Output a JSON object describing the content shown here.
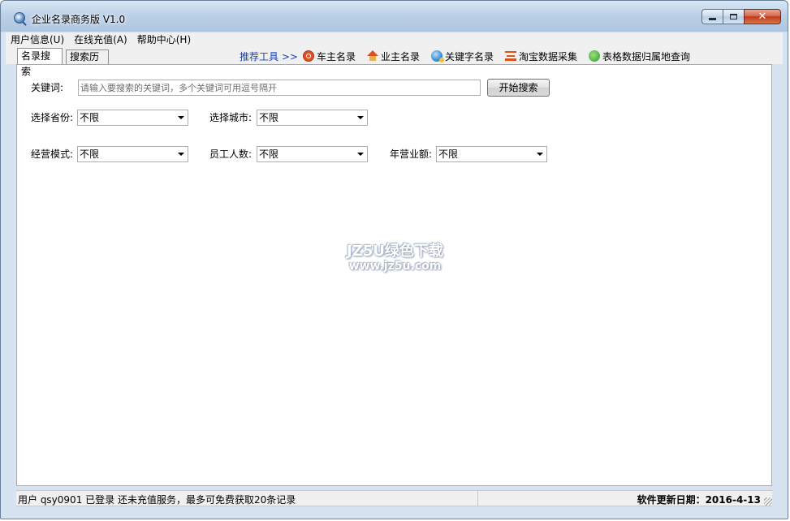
{
  "window": {
    "title": "企业名录商务版 V1.0",
    "icon": "magnifier-globe-icon"
  },
  "menu": {
    "items": [
      {
        "label": "用户信息(U)"
      },
      {
        "label": "在线充值(A)"
      },
      {
        "label": "帮助中心(H)"
      }
    ]
  },
  "tabs": {
    "search": "名录搜索",
    "history": "搜索历史"
  },
  "tools": {
    "label": "推荐工具 >>",
    "items": [
      {
        "label": "车主名录",
        "icon": "car-icon"
      },
      {
        "label": "业主名录",
        "icon": "house-icon"
      },
      {
        "label": "关键字名录",
        "icon": "globe-icon"
      },
      {
        "label": "淘宝数据采集",
        "icon": "bag-icon"
      },
      {
        "label": "表格数据归属地查询",
        "icon": "phone-icon"
      }
    ]
  },
  "form": {
    "keyword_label": "关键词:",
    "keyword_placeholder": "请输入要搜索的关键词，多个关键词可用逗号隔开",
    "search_button": "开始搜索",
    "province_label": "选择省份:",
    "province_value": "不限",
    "city_label": "选择城市:",
    "city_value": "不限",
    "mode_label": "经营模式:",
    "mode_value": "不限",
    "staff_label": "员工人数:",
    "staff_value": "不限",
    "revenue_label": "年营业额:",
    "revenue_value": "不限"
  },
  "watermark": {
    "line1": "JZ5U绿色下载",
    "line2": "www.jz5u.com"
  },
  "status": {
    "left": "用户 qsy0901 已登录 还未充值服务，最多可免费获取20条记录",
    "right": "软件更新日期：2016-4-13"
  }
}
